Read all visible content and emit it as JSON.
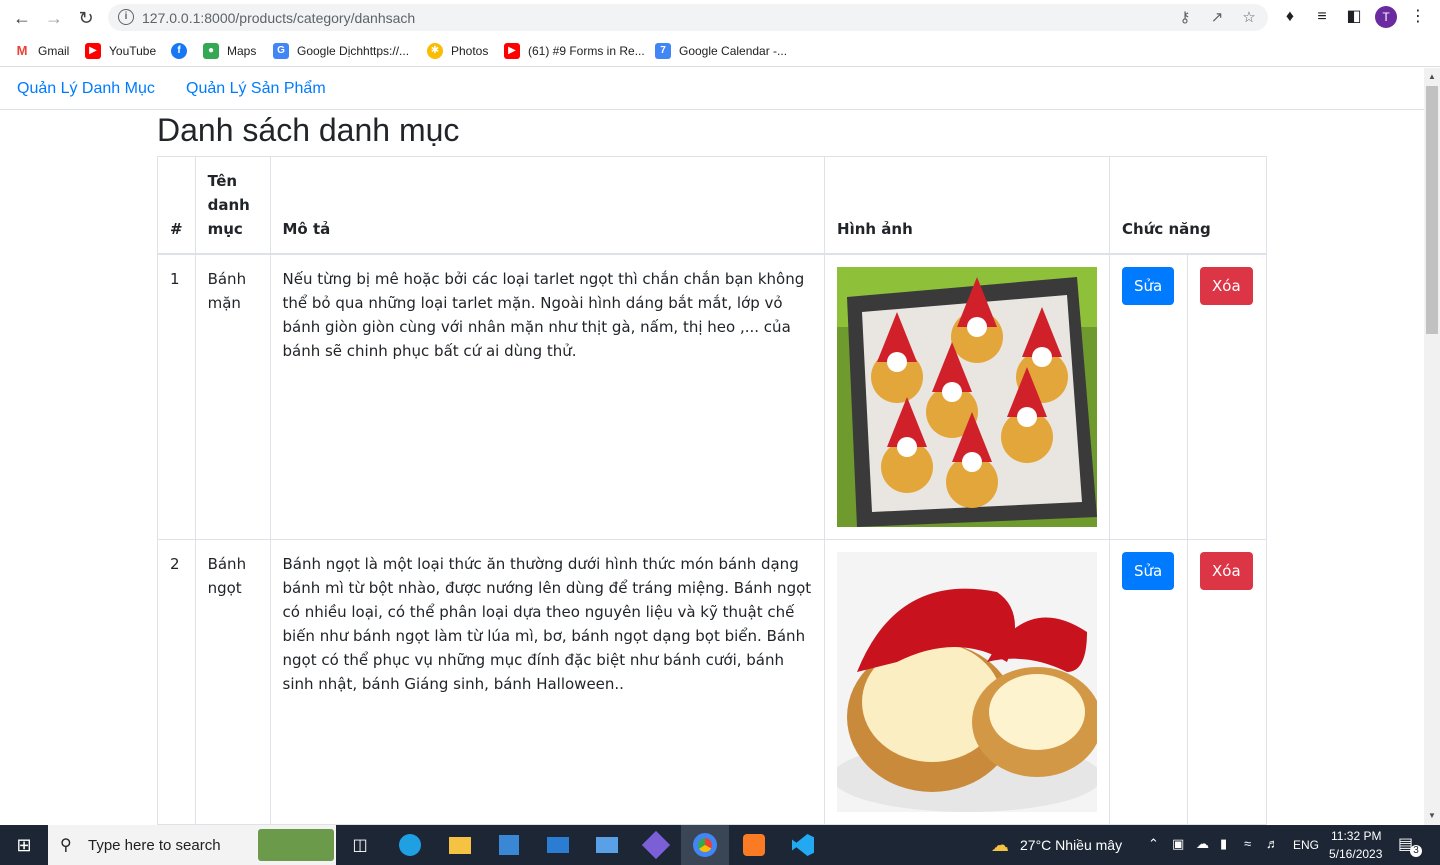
{
  "browser": {
    "url": "127.0.0.1:8000/products/category/danhsach",
    "bookmarks": [
      {
        "label": "Gmail",
        "icon": "gmail-icon",
        "color": "#ea4335"
      },
      {
        "label": "YouTube",
        "icon": "youtube-icon",
        "color": "#ff0000"
      },
      {
        "label": "",
        "icon": "facebook-icon",
        "color": "#1877f2"
      },
      {
        "label": "Maps",
        "icon": "maps-icon",
        "color": "#34a853"
      },
      {
        "label": "Google Dịchhttps://...",
        "icon": "translate-icon",
        "color": "#4285f4"
      },
      {
        "label": "Photos",
        "icon": "photos-icon",
        "color": "#fbbc04"
      },
      {
        "label": "(61) #9 Forms in Re...",
        "icon": "youtube-icon",
        "color": "#ff0000"
      },
      {
        "label": "Google Calendar -...",
        "icon": "calendar-icon",
        "color": "#4285f4"
      }
    ],
    "avatar_letter": "T"
  },
  "nav": {
    "category_link": "Quản Lý Danh Mục",
    "product_link": "Quản Lý Sản Phẩm"
  },
  "page": {
    "title": "Danh sách danh mục"
  },
  "table": {
    "headers": {
      "index": "#",
      "name": "Tên danh mục",
      "description": "Mô tả",
      "image": "Hình ảnh",
      "actions": "Chức năng"
    },
    "rows": [
      {
        "index": "1",
        "name": "Bánh mặn",
        "description": "Nếu từng bị mê hoặc bởi các loại tarlet ngọt thì chắn chắn bạn không thể bỏ qua những loại tarlet mặn. Ngoài hình dáng bắt mắt, lớp vỏ bánh giòn giòn cùng với nhân mặn như thịt gà, nấm, thị heo ,... của bánh sẽ chinh phục bất cứ ai dùng thử.",
        "edit_label": "Sửa",
        "delete_label": "Xóa"
      },
      {
        "index": "2",
        "name": "Bánh ngọt",
        "description": "Bánh ngọt là một loại thức ăn thường dưới hình thức món bánh dạng bánh mì từ bột nhào, được nướng lên dùng để tráng miệng. Bánh ngọt có nhiều loại, có thể phân loại dựa theo nguyên liệu và kỹ thuật chế biến như bánh ngọt làm từ lúa mì, bơ, bánh ngọt dạng bọt biển. Bánh ngọt có thể phục vụ những mục đính đặc biệt như bánh cưới, bánh sinh nhật, bánh Giáng sinh, bánh Halloween..",
        "edit_label": "Sửa",
        "delete_label": "Xóa"
      }
    ]
  },
  "taskbar": {
    "search_placeholder": "Type here to search",
    "weather": "27°C  Nhiều mây",
    "language": "ENG",
    "time": "11:32 PM",
    "date": "5/16/2023",
    "notifications": "3"
  },
  "colors": {
    "link": "#007bff",
    "edit_button": "#007bff",
    "delete_button": "#dc3545"
  }
}
